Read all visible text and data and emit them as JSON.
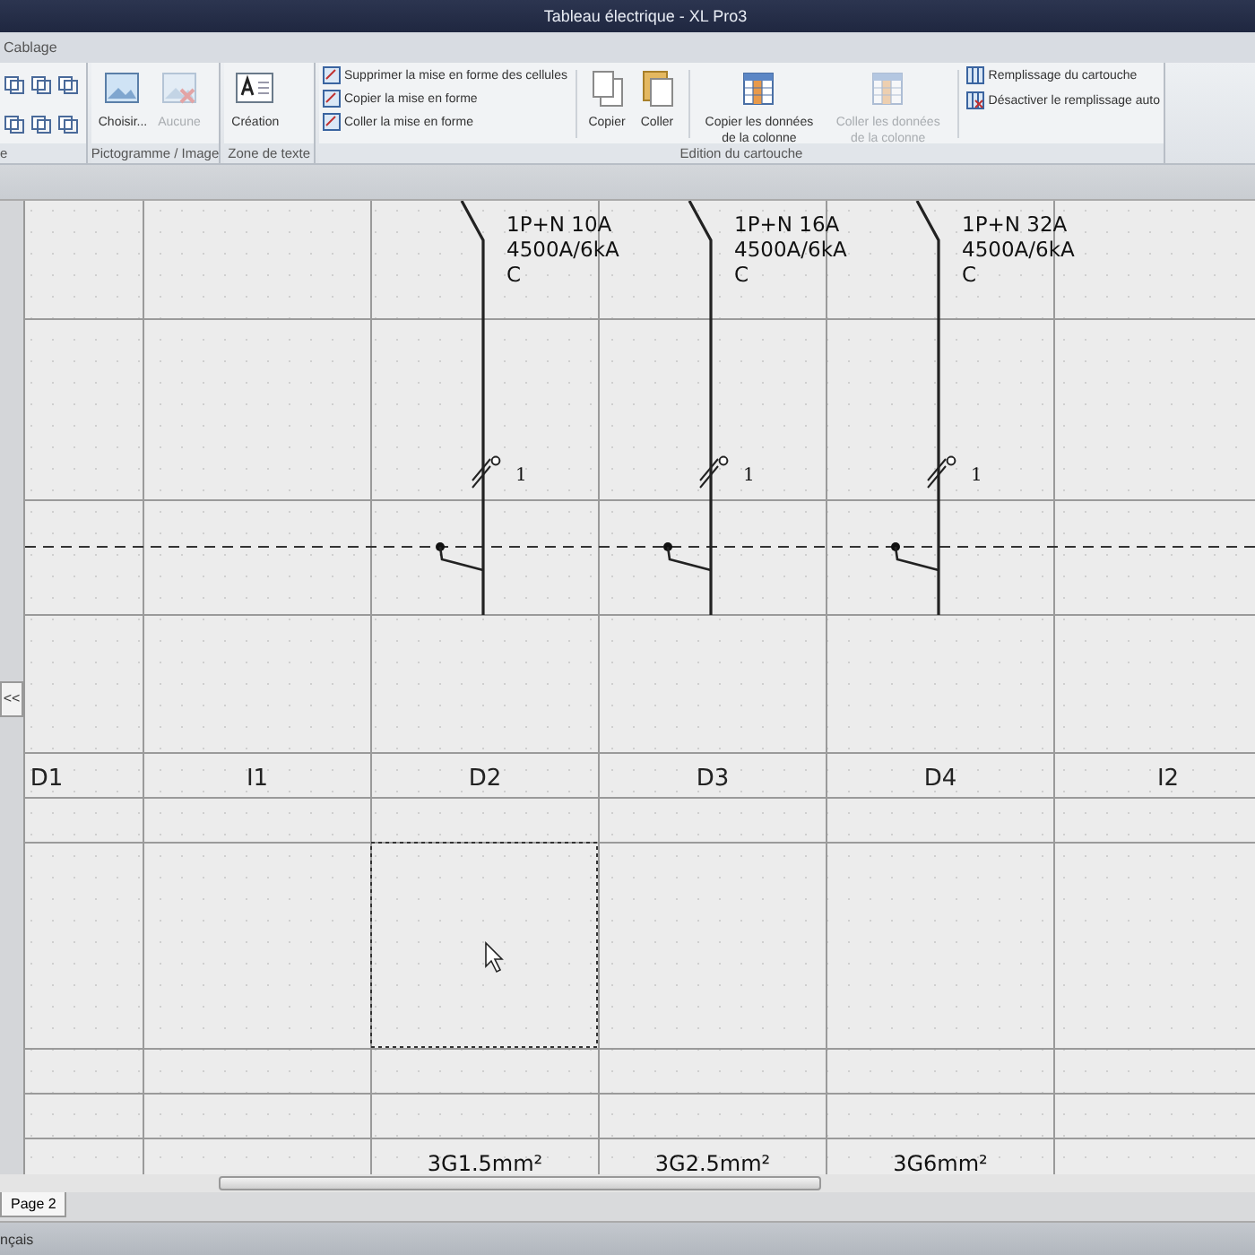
{
  "window": {
    "title": "Tableau électrique - XL Pro3"
  },
  "ribbon_tab": {
    "label": "Cablage"
  },
  "ribbon_groups": [
    {
      "label": "e"
    },
    {
      "label": "Pictogramme / Image",
      "buttons": [
        {
          "label": "Choisir...",
          "disabled": false
        },
        {
          "label": "Aucune",
          "disabled": true
        }
      ]
    },
    {
      "label": "Zone de texte",
      "buttons": [
        {
          "label": "Création",
          "disabled": false
        }
      ]
    },
    {
      "label": "Edition du cartouche",
      "format_commands": [
        "Supprimer la mise en forme des cellules",
        "Copier la mise en forme",
        "Coller la mise en forme"
      ],
      "buttons": [
        {
          "label": "Copier",
          "disabled": false
        },
        {
          "label": "Coller",
          "disabled": false
        },
        {
          "label": "Copier les données de la colonne",
          "disabled": false
        },
        {
          "label": "Coller les données de la colonne",
          "disabled": true
        }
      ],
      "fill_commands": [
        "Remplissage du cartouche",
        "Désactiver le remplissage auto"
      ]
    }
  ],
  "panel_toggle": "<<",
  "columns": [
    {
      "label": "D1",
      "selected": false
    },
    {
      "label": "I1",
      "selected": false
    },
    {
      "label": "D2",
      "selected": true,
      "circuit": {
        "rating": "1P+N 10A",
        "breaking": "4500A/6kA",
        "curve": "C",
        "conductors": "1",
        "cable": "3G1.5mm²"
      }
    },
    {
      "label": "D3",
      "selected": false,
      "circuit": {
        "rating": "1P+N 16A",
        "breaking": "4500A/6kA",
        "curve": "C",
        "conductors": "1",
        "cable": "3G2.5mm²"
      }
    },
    {
      "label": "D4",
      "selected": false,
      "circuit": {
        "rating": "1P+N 32A",
        "breaking": "4500A/6kA",
        "curve": "C",
        "conductors": "1",
        "cable": "3G6mm²"
      }
    },
    {
      "label": "I2",
      "selected": false
    }
  ],
  "page_tabs": [
    {
      "label": "Page 2",
      "selected": true
    }
  ],
  "status_bar": {
    "language": "nçais"
  }
}
